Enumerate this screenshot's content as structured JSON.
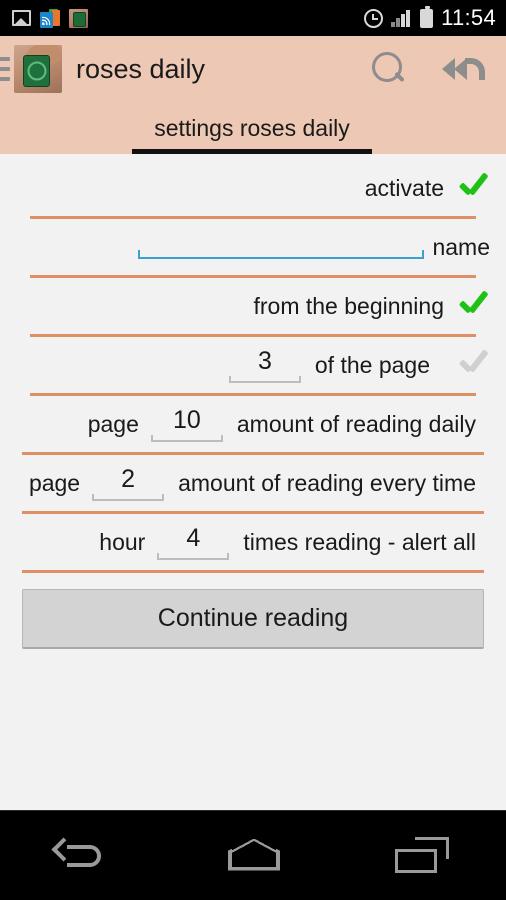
{
  "status_bar": {
    "time": "11:54",
    "icons": [
      "photo-icon",
      "newsstand-icon",
      "app-notification-icon",
      "alarm-icon",
      "signal-icon",
      "battery-icon"
    ]
  },
  "action_bar": {
    "menu_icon": "hamburger-menu-icon",
    "app_icon": "app-logo-icon",
    "title": "roses daily",
    "search_icon": "search-icon",
    "back_all_icon": "reply-all-arrow-icon",
    "background_color": "#EDC8B4"
  },
  "tab": {
    "label": "settings roses daily",
    "indicator_color": "#111111"
  },
  "form": {
    "divider_color": "#DE8F66",
    "check_on_color": "#1FC214",
    "check_off_color": "#CFCFCF",
    "focus_color": "#3C9FD4",
    "rows": [
      {
        "label": "activate",
        "checked": true
      },
      {
        "label": "name",
        "input_value": "",
        "input_placeholder": ""
      },
      {
        "label": "from the beginning",
        "checked": true
      },
      {
        "prefix": "",
        "value": "3",
        "label": "of the page",
        "checked": false
      },
      {
        "prefix": "page",
        "value": "10",
        "label": "amount of reading daily"
      },
      {
        "prefix": "page",
        "value": "2",
        "label": "amount of reading every time"
      },
      {
        "prefix": "hour",
        "value": "4",
        "label": "times reading - alert all"
      }
    ],
    "continue_button": "Continue reading"
  },
  "nav_bar": {
    "back": "back-icon",
    "home": "home-icon",
    "recents": "recents-icon"
  }
}
